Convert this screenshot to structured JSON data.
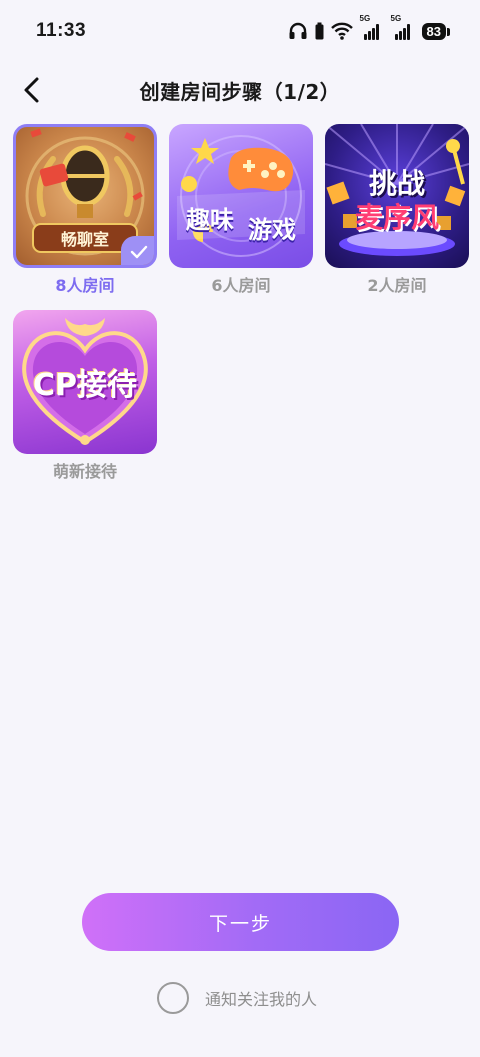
{
  "status_bar": {
    "time": "11:33",
    "battery": "83",
    "signal_tag_1": "5G",
    "signal_tag_2": "5G",
    "icons": [
      "headphones-icon",
      "battery-saver-icon",
      "wifi-icon",
      "signal-icon",
      "signal-icon",
      "battery-icon"
    ]
  },
  "header": {
    "title": "创建房间步骤（1/2）",
    "back_icon": "chevron-left-icon"
  },
  "rooms": [
    {
      "label": "8人房间",
      "art_text": "畅聊室",
      "selected": true
    },
    {
      "label": "6人房间",
      "art_text_line1": "趣味",
      "art_text_line2": "游戏",
      "selected": false
    },
    {
      "label": "2人房间",
      "art_text_line1": "挑战",
      "art_text_line2": "麦序风",
      "selected": false
    },
    {
      "label": "萌新接待",
      "art_text": "CP接待",
      "selected": false
    }
  ],
  "actions": {
    "next_label": "下一步",
    "notify_label": "通知关注我的人"
  },
  "colors": {
    "accent": "#7d6cf0",
    "selected_border": "#8f7ef5",
    "muted_label": "#9a9a9a",
    "button_gradient_start": "#d070f8",
    "button_gradient_end": "#8a66f4"
  }
}
